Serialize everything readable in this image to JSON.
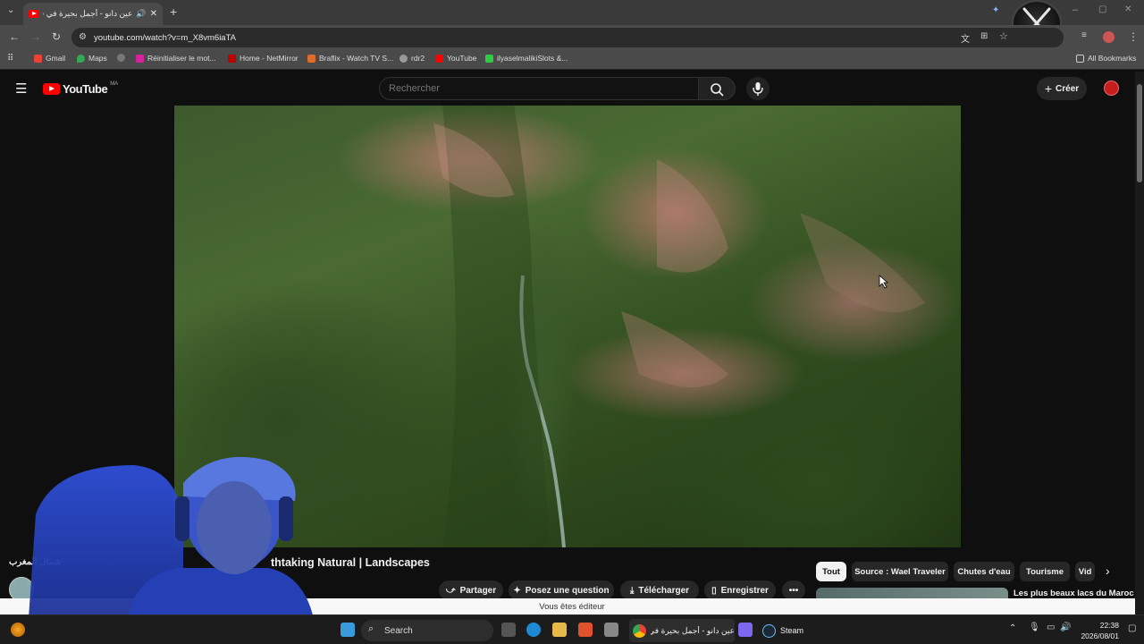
{
  "browser": {
    "tab_title": "عين دانو - أجمل بحيرة في ف...",
    "url": "youtube.com/watch?v=m_X8vm6iaTA",
    "bookmarks": [
      "Gmail",
      "Maps",
      "Réinitialiser le mot...",
      "Home - NetMirror",
      "Braflix - Watch TV S...",
      "rdr2",
      "YouTube",
      "ilyaselmalikiSlots &...",
      "All Bookmarks"
    ]
  },
  "youtube": {
    "logo_text": "YouTube",
    "region": "MA",
    "search_placeholder": "Rechercher",
    "create_label": "Créer"
  },
  "video": {
    "title": "thtaking Natural | Landscapes",
    "channel_name": "شمال المغرب",
    "actions": [
      "Partager",
      "Posez une question",
      "Télécharger",
      "Enregistrer"
    ]
  },
  "chips": [
    "Tout",
    "Source : Wael Traveler",
    "Chutes d'eau",
    "Tourisme",
    "Vid"
  ],
  "recommendation_title": "Les plus beaux lacs du Maroc",
  "editor_notice": "Vous êtes éditeur",
  "taskbar": {
    "search_label": "Search",
    "chrome_title": "عين دانو - أجمل بحيرة في",
    "steam_label": "Steam",
    "time": "22:38",
    "date": "2026/08/01"
  },
  "colors": {
    "youtube_red": "#ff0000",
    "bg": "#0f0f0f",
    "chip_active": "#f1f1f1"
  }
}
